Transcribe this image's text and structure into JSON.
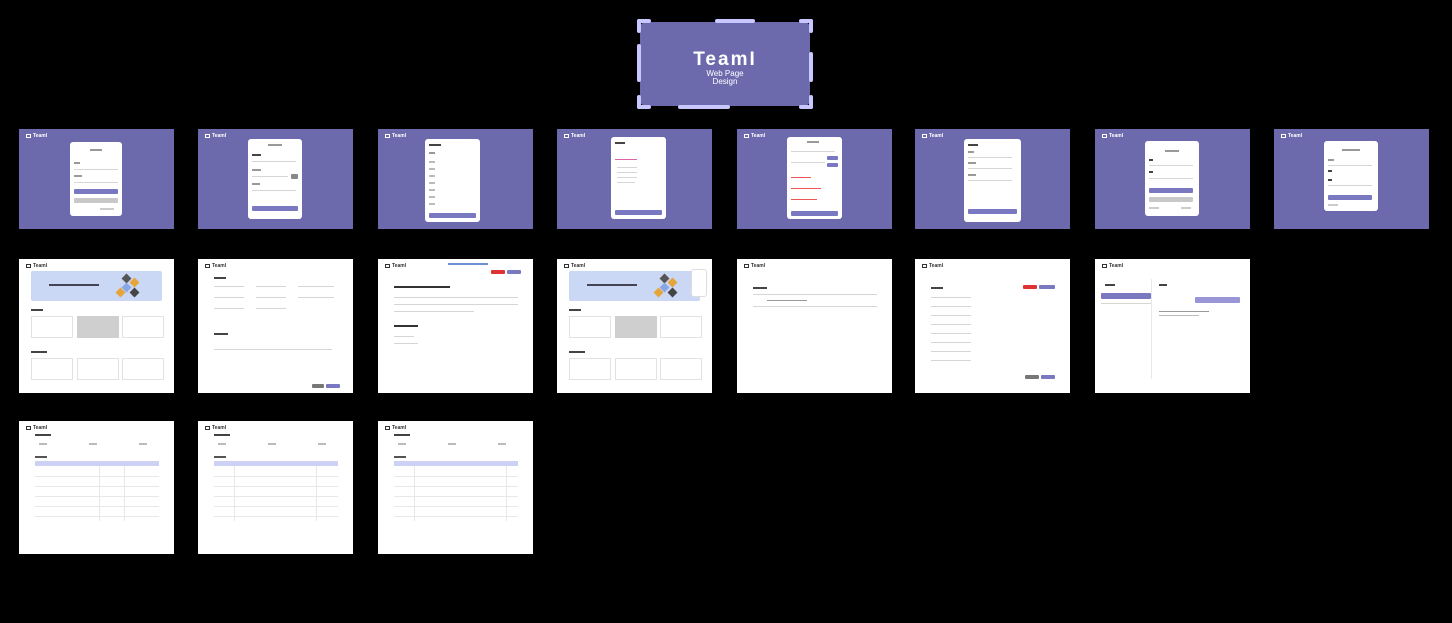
{
  "title_card": {
    "title": "TeamI",
    "subtitle_line1": "Web Page",
    "subtitle_line2": "Design"
  },
  "brand": "TeamI",
  "colors": {
    "background": "#000000",
    "brand_purple": "#6c6aad",
    "frame_accent": "#c9c7ff",
    "banner_blue": "#cad8f5",
    "danger": "#dd3333"
  },
  "row1_count": 8,
  "row2_count": 7,
  "row3_count": 3
}
